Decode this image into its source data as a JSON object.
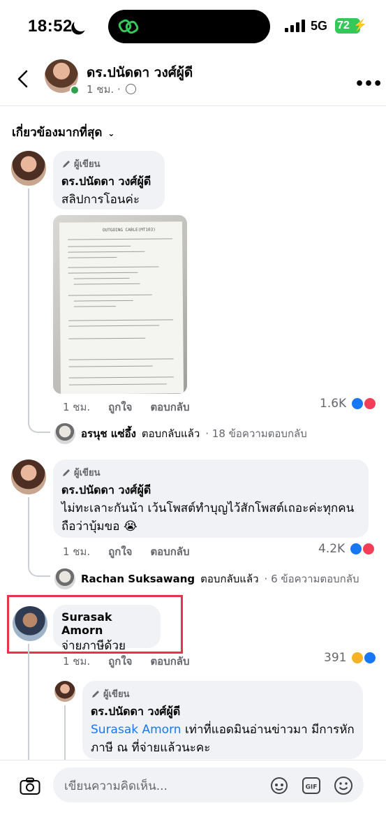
{
  "status_bar": {
    "time": "18:52",
    "network": "5G",
    "battery": "72"
  },
  "header": {
    "title": "ดร.ปนัดดา วงศ์ผู้ดี",
    "time": "1 ชม.",
    "separator": "·"
  },
  "filter": {
    "label": "เกี่ยวข้องมากที่สุด"
  },
  "comments": [
    {
      "badge": "ผู้เขียน",
      "name": "ดร.ปนัดดา วงศ์ผู้ดี",
      "text": "สลิปการโอนค่ะ",
      "time": "1 ชม.",
      "like": "ถูกใจ",
      "reply": "ตอบกลับ",
      "count": "1.6K",
      "replies_name": "อรนุช แซ่อึ้ง",
      "replies_action": "ตอบกลับแล้ว",
      "replies_meta": "· 18 ข้อความตอบกลับ",
      "attachment": {
        "header": "OUTGOING CABLE(MT103)"
      }
    },
    {
      "badge": "ผู้เขียน",
      "name": "ดร.ปนัดดา วงศ์ผู้ดี",
      "text": "ไม่ทะเลาะกันน้า เว้นโพสต์ทำบุญไว้สักโพสต์เถอะค่ะทุกคน ถือว่าบุ้มขอ 😭",
      "time": "1 ชม.",
      "like": "ถูกใจ",
      "reply": "ตอบกลับ",
      "count": "4.2K",
      "replies_name": "Rachan Suksawang",
      "replies_action": "ตอบกลับแล้ว",
      "replies_meta": "· 6 ข้อความตอบกลับ"
    },
    {
      "name": "Surasak Amorn",
      "text": "จ่ายภาษีด้วย",
      "time": "1 ชม.",
      "like": "ถูกใจ",
      "reply": "ตอบกลับ",
      "count": "391"
    }
  ],
  "nested_reply": {
    "badge": "ผู้เขียน",
    "name": "ดร.ปนัดดา วงศ์ผู้ดี",
    "mention": "Surasak Amorn",
    "text": "เท่าที่แอดมินอ่านข่าวมา มีการหักภาษี ณ ที่จ่ายแล้วนะคะ"
  },
  "composer": {
    "placeholder": "เขียนความคิดเห็น..."
  },
  "icons": [
    "moon-icon",
    "link-icon",
    "signal-icon",
    "back-arrow-icon",
    "globe-icon",
    "more-icon",
    "chevron-down-icon",
    "pen-icon",
    "like-reaction-icon",
    "love-reaction-icon",
    "haha-reaction-icon",
    "camera-icon",
    "avatar-sticker-icon",
    "gif-icon",
    "emoji-icon"
  ],
  "colors": {
    "accent": "#1877f2",
    "highlight": "#e5344a",
    "online": "#31a24c",
    "battery": "#34c759"
  }
}
